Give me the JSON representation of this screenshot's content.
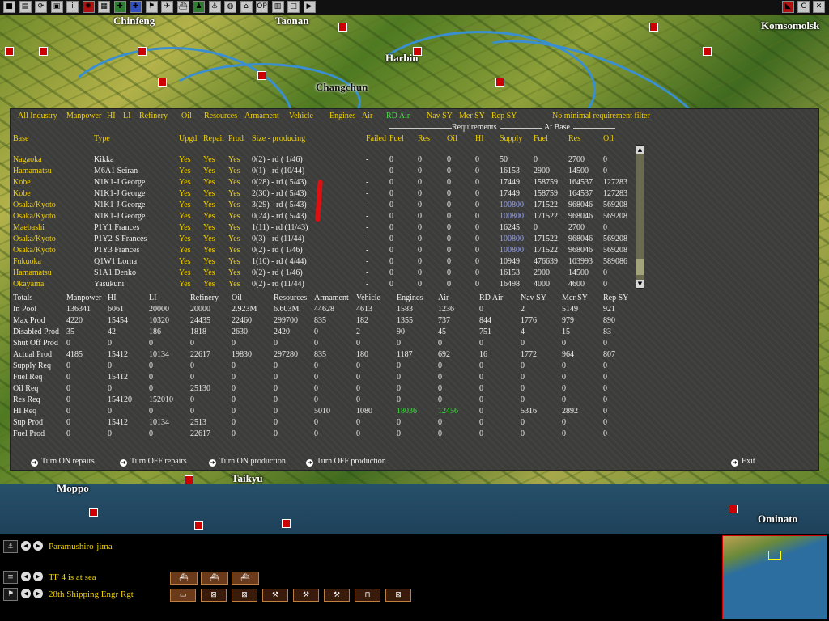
{
  "toolbar": {
    "left_icons": [
      {
        "name": "menu-icon",
        "glyph": "■",
        "style": ""
      },
      {
        "name": "intel-icon",
        "glyph": "▤",
        "style": ""
      },
      {
        "name": "cycle-icon",
        "glyph": "⟳",
        "style": ""
      },
      {
        "name": "save-icon",
        "glyph": "▣",
        "style": ""
      },
      {
        "name": "info-icon",
        "glyph": "i",
        "style": ""
      },
      {
        "name": "rising-sun-icon",
        "glyph": "✺",
        "style": "red"
      },
      {
        "name": "list-icon",
        "glyph": "▦",
        "style": ""
      },
      {
        "name": "army-icon",
        "glyph": "✚",
        "style": "green"
      },
      {
        "name": "navy-icon",
        "glyph": "✚",
        "style": "blue"
      },
      {
        "name": "flag-icon",
        "glyph": "⚑",
        "style": ""
      },
      {
        "name": "aircraft-icon",
        "glyph": "✈",
        "style": ""
      },
      {
        "name": "ship-icon",
        "glyph": "⛴",
        "style": ""
      },
      {
        "name": "soldier-icon",
        "glyph": "♟",
        "style": "green"
      },
      {
        "name": "fleet-icon",
        "glyph": "⚓",
        "style": ""
      },
      {
        "name": "globe-icon",
        "glyph": "◍",
        "style": ""
      },
      {
        "name": "base-icon",
        "glyph": "⌂",
        "style": ""
      },
      {
        "name": "op-icon",
        "glyph": "OP",
        "style": ""
      },
      {
        "name": "industry-icon",
        "glyph": "▥",
        "style": ""
      },
      {
        "name": "window-icon",
        "glyph": "□",
        "style": ""
      },
      {
        "name": "end-turn-icon",
        "glyph": "▶",
        "style": ""
      }
    ],
    "right_icons": [
      {
        "name": "side-flag-icon",
        "glyph": "◣",
        "style": "red"
      },
      {
        "name": "c-icon",
        "glyph": "C",
        "style": ""
      },
      {
        "name": "close-icon",
        "glyph": "✕",
        "style": ""
      }
    ]
  },
  "map": {
    "cities": [
      "Komsomolsk",
      "Harbin",
      "Changchun",
      "Taikyu",
      "Moppo",
      "Ominato",
      "Taonan",
      "Chinfeng"
    ]
  },
  "panel": {
    "filters": [
      {
        "label": "All Industry",
        "active": false
      },
      {
        "label": "Manpower",
        "active": false
      },
      {
        "label": "HI",
        "active": false
      },
      {
        "label": "LI",
        "active": false
      },
      {
        "label": "Refinery",
        "active": false
      },
      {
        "label": "Oil",
        "active": false
      },
      {
        "label": "Resources",
        "active": false
      },
      {
        "label": "Armament",
        "active": false
      },
      {
        "label": "Vehicle",
        "active": false
      },
      {
        "label": "Engines",
        "active": false
      },
      {
        "label": "Air",
        "active": false
      },
      {
        "label": "RD Air",
        "active": true
      },
      {
        "label": "Nav SY",
        "active": false
      },
      {
        "label": "Mer SY",
        "active": false
      },
      {
        "label": "Rep SY",
        "active": false
      },
      {
        "label": "No minimal requirement filter",
        "active": false
      }
    ],
    "group_headers": {
      "requirements": "Requirements",
      "at_base": "At Base"
    },
    "columns": [
      "Base",
      "Type",
      "Upgd",
      "Repair",
      "Prod",
      "Size - producing",
      "Failed",
      "Fuel",
      "Res",
      "Oil",
      "HI",
      "Supply",
      "Fuel",
      "Res",
      "Oil"
    ],
    "rows": [
      {
        "base": "Nagaoka",
        "type": "Kikka",
        "upgd": "Yes",
        "repair": "Yes",
        "prod": "Yes",
        "size": "0(2) - rd ( 1/46)",
        "failed": "-",
        "r_fuel": "0",
        "r_res": "0",
        "r_oil": "0",
        "r_hi": "0",
        "supply": "50",
        "fuel": "0",
        "res": "2700",
        "oil": "0",
        "hl": false
      },
      {
        "base": "Hamamatsu",
        "type": "M6A1 Seiran",
        "upgd": "Yes",
        "repair": "Yes",
        "prod": "Yes",
        "size": "0(1) - rd (10/44)",
        "failed": "-",
        "r_fuel": "0",
        "r_res": "0",
        "r_oil": "0",
        "r_hi": "0",
        "supply": "16153",
        "fuel": "2900",
        "res": "14500",
        "oil": "0",
        "hl": false
      },
      {
        "base": "Kobe",
        "type": "N1K1-J George",
        "upgd": "Yes",
        "repair": "Yes",
        "prod": "Yes",
        "size": "0(28) - rd ( 5/43)",
        "failed": "-",
        "r_fuel": "0",
        "r_res": "0",
        "r_oil": "0",
        "r_hi": "0",
        "supply": "17449",
        "fuel": "158759",
        "res": "164537",
        "oil": "127283",
        "hl": false
      },
      {
        "base": "Kobe",
        "type": "N1K1-J George",
        "upgd": "Yes",
        "repair": "Yes",
        "prod": "Yes",
        "size": "2(30) - rd ( 5/43)",
        "failed": "-",
        "r_fuel": "0",
        "r_res": "0",
        "r_oil": "0",
        "r_hi": "0",
        "supply": "17449",
        "fuel": "158759",
        "res": "164537",
        "oil": "127283",
        "hl": false
      },
      {
        "base": "Osaka/Kyoto",
        "type": "N1K1-J George",
        "upgd": "Yes",
        "repair": "Yes",
        "prod": "Yes",
        "size": "3(29) - rd ( 5/43)",
        "failed": "-",
        "r_fuel": "0",
        "r_res": "0",
        "r_oil": "0",
        "r_hi": "0",
        "supply": "100800",
        "fuel": "171522",
        "res": "968046",
        "oil": "569208",
        "hl": true
      },
      {
        "base": "Osaka/Kyoto",
        "type": "N1K1-J George",
        "upgd": "Yes",
        "repair": "Yes",
        "prod": "Yes",
        "size": "0(24) - rd ( 5/43)",
        "failed": "-",
        "r_fuel": "0",
        "r_res": "0",
        "r_oil": "0",
        "r_hi": "0",
        "supply": "100800",
        "fuel": "171522",
        "res": "968046",
        "oil": "569208",
        "hl": true
      },
      {
        "base": "Maebashi",
        "type": "P1Y1 Frances",
        "upgd": "Yes",
        "repair": "Yes",
        "prod": "Yes",
        "size": "1(11) - rd (11/43)",
        "failed": "-",
        "r_fuel": "0",
        "r_res": "0",
        "r_oil": "0",
        "r_hi": "0",
        "supply": "16245",
        "fuel": "0",
        "res": "2700",
        "oil": "0",
        "hl": false
      },
      {
        "base": "Osaka/Kyoto",
        "type": "P1Y2-S Frances",
        "upgd": "Yes",
        "repair": "Yes",
        "prod": "Yes",
        "size": "0(3) - rd (11/44)",
        "failed": "-",
        "r_fuel": "0",
        "r_res": "0",
        "r_oil": "0",
        "r_hi": "0",
        "supply": "100800",
        "fuel": "171522",
        "res": "968046",
        "oil": "569208",
        "hl": true
      },
      {
        "base": "Osaka/Kyoto",
        "type": "P1Y3 Frances",
        "upgd": "Yes",
        "repair": "Yes",
        "prod": "Yes",
        "size": "0(2) - rd ( 1/46)",
        "failed": "-",
        "r_fuel": "0",
        "r_res": "0",
        "r_oil": "0",
        "r_hi": "0",
        "supply": "100800",
        "fuel": "171522",
        "res": "968046",
        "oil": "569208",
        "hl": true
      },
      {
        "base": "Fukuoka",
        "type": "Q1W1 Lorna",
        "upgd": "Yes",
        "repair": "Yes",
        "prod": "Yes",
        "size": "1(10) - rd ( 4/44)",
        "failed": "-",
        "r_fuel": "0",
        "r_res": "0",
        "r_oil": "0",
        "r_hi": "0",
        "supply": "10949",
        "fuel": "476639",
        "res": "103993",
        "oil": "589086",
        "hl": false
      },
      {
        "base": "Hamamatsu",
        "type": "S1A1 Denko",
        "upgd": "Yes",
        "repair": "Yes",
        "prod": "Yes",
        "size": "0(2) - rd ( 1/46)",
        "failed": "-",
        "r_fuel": "0",
        "r_res": "0",
        "r_oil": "0",
        "r_hi": "0",
        "supply": "16153",
        "fuel": "2900",
        "res": "14500",
        "oil": "0",
        "hl": false
      },
      {
        "base": "Okayama",
        "type": "Yasukuni",
        "upgd": "Yes",
        "repair": "Yes",
        "prod": "Yes",
        "size": "0(2) - rd (11/44)",
        "failed": "-",
        "r_fuel": "0",
        "r_res": "0",
        "r_oil": "0",
        "r_hi": "0",
        "supply": "16498",
        "fuel": "4000",
        "res": "4600",
        "oil": "0",
        "hl": false
      }
    ],
    "totals": {
      "headers": [
        "Totals",
        "Manpower",
        "HI",
        "LI",
        "Refinery",
        "Oil",
        "Resources",
        "Armament",
        "Vehicle",
        "Engines",
        "Air",
        "RD Air",
        "Nav SY",
        "Mer SY",
        "Rep SY"
      ],
      "rows": [
        {
          "label": "In Pool",
          "values": [
            "136341",
            "6061",
            "20000",
            "20000",
            "2.923M",
            "6.603M",
            "44628",
            "4613",
            "1583",
            "1236",
            "0",
            "2",
            "5149",
            "921"
          ]
        },
        {
          "label": "Max Prod",
          "values": [
            "4220",
            "15454",
            "10320",
            "24435",
            "22460",
            "299700",
            "835",
            "182",
            "1355",
            "737",
            "844",
            "1776",
            "979",
            "890"
          ]
        },
        {
          "label": "Disabled Prod",
          "values": [
            "35",
            "42",
            "186",
            "1818",
            "2630",
            "2420",
            "0",
            "2",
            "90",
            "45",
            "751",
            "4",
            "15",
            "83"
          ]
        },
        {
          "label": "Shut Off Prod",
          "values": [
            "0",
            "0",
            "0",
            "0",
            "0",
            "0",
            "0",
            "0",
            "0",
            "0",
            "0",
            "0",
            "0",
            "0"
          ]
        },
        {
          "label": "Actual Prod",
          "values": [
            "4185",
            "15412",
            "10134",
            "22617",
            "19830",
            "297280",
            "835",
            "180",
            "1187",
            "692",
            "16",
            "1772",
            "964",
            "807"
          ]
        },
        {
          "label": "Supply Req",
          "values": [
            "0",
            "0",
            "0",
            "0",
            "0",
            "0",
            "0",
            "0",
            "0",
            "0",
            "0",
            "0",
            "0",
            "0"
          ]
        },
        {
          "label": "Fuel Req",
          "values": [
            "0",
            "15412",
            "0",
            "0",
            "0",
            "0",
            "0",
            "0",
            "0",
            "0",
            "0",
            "0",
            "0",
            "0"
          ]
        },
        {
          "label": "Oil Req",
          "values": [
            "0",
            "0",
            "0",
            "25130",
            "0",
            "0",
            "0",
            "0",
            "0",
            "0",
            "0",
            "0",
            "0",
            "0"
          ]
        },
        {
          "label": "Res Req",
          "values": [
            "0",
            "154120",
            "152010",
            "0",
            "0",
            "0",
            "0",
            "0",
            "0",
            "0",
            "0",
            "0",
            "0",
            "0"
          ]
        },
        {
          "label": "HI Req",
          "values": [
            "0",
            "0",
            "0",
            "0",
            "0",
            "0",
            "5010",
            "1080",
            "18036",
            "12456",
            "0",
            "5316",
            "2892",
            "0"
          ],
          "green": [
            8,
            9
          ]
        },
        {
          "label": "Sup Prod",
          "values": [
            "0",
            "15412",
            "10134",
            "2513",
            "0",
            "0",
            "0",
            "0",
            "0",
            "0",
            "0",
            "0",
            "0",
            "0"
          ]
        },
        {
          "label": "Fuel Prod",
          "values": [
            "0",
            "0",
            "0",
            "22617",
            "0",
            "0",
            "0",
            "0",
            "0",
            "0",
            "0",
            "0",
            "0",
            "0"
          ]
        }
      ]
    },
    "buttons": {
      "turn_on_repairs": "Turn ON repairs",
      "turn_off_repairs": "Turn OFF repairs",
      "turn_on_production": "Turn ON production",
      "turn_off_production": "Turn OFF production",
      "exit": "Exit"
    }
  },
  "bottom": {
    "base_name": "Paramushiro-jima",
    "tf_status": "TF 4 is at sea",
    "unit_name": "28th Shipping Engr Rgt"
  }
}
